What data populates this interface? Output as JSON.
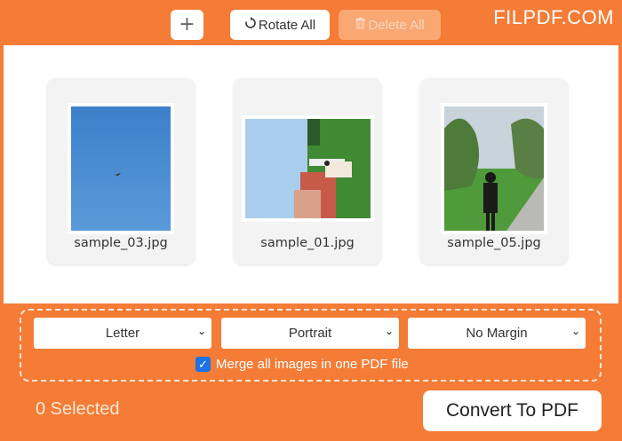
{
  "toolbar": {
    "add_label": "+",
    "rotate_icon": "rotate-icon",
    "rotate_label": "Rotate All",
    "delete_icon": "trash-icon",
    "delete_label": "Delete All"
  },
  "brand": "FILPDF.COM",
  "images": [
    {
      "name": "sample_03.jpg"
    },
    {
      "name": "sample_01.jpg"
    },
    {
      "name": "sample_05.jpg"
    }
  ],
  "options": {
    "page_size": "Letter",
    "orientation": "Portrait",
    "margin": "No Margin",
    "merge_checked": true,
    "merge_label": "Merge all images in one PDF file"
  },
  "footer": {
    "selected_text": "0 Selected",
    "convert_label": "Convert To PDF"
  },
  "colors": {
    "accent": "#f47c36",
    "checkbox": "#1a73e8"
  }
}
